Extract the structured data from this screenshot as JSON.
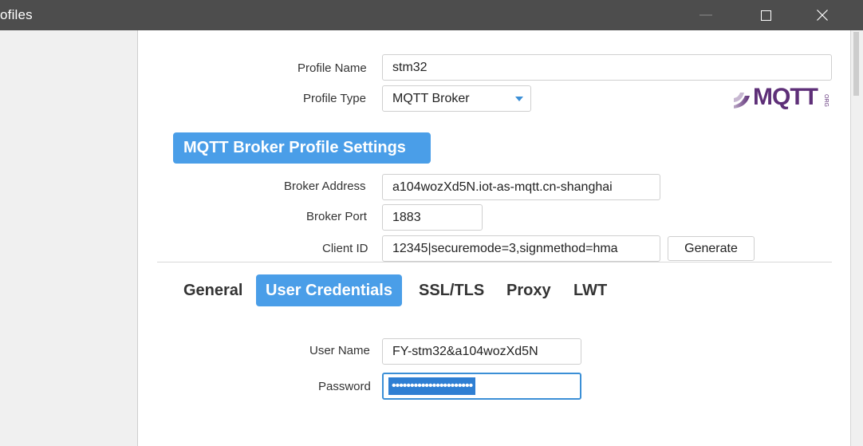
{
  "window": {
    "title": "ofiles",
    "minimize_glyph": "—",
    "colors": {
      "titlebar": "#4d4d4d",
      "accent": "#4a9ee8"
    }
  },
  "form": {
    "profile_name_label": "Profile Name",
    "profile_name_value": "stm32",
    "profile_type_label": "Profile Type",
    "profile_type_value": "MQTT Broker"
  },
  "logo": {
    "text": "MQTT",
    "side_text": "ORG"
  },
  "section": {
    "title": "MQTT Broker Profile Settings"
  },
  "broker": {
    "address_label": "Broker Address",
    "address_value": "a104wozXd5N.iot-as-mqtt.cn-shanghai",
    "port_label": "Broker Port",
    "port_value": "1883",
    "client_id_label": "Client ID",
    "client_id_value": "12345|securemode=3,signmethod=hma",
    "generate_label": "Generate"
  },
  "tabs": [
    {
      "label": "General",
      "active": false
    },
    {
      "label": "User Credentials",
      "active": true
    },
    {
      "label": "SSL/TLS",
      "active": false
    },
    {
      "label": "Proxy",
      "active": false
    },
    {
      "label": "LWT",
      "active": false
    }
  ],
  "credentials": {
    "username_label": "User Name",
    "username_value": "FY-stm32&a104wozXd5N",
    "password_label": "Password",
    "password_value": "••••••••••••••••••••••"
  }
}
